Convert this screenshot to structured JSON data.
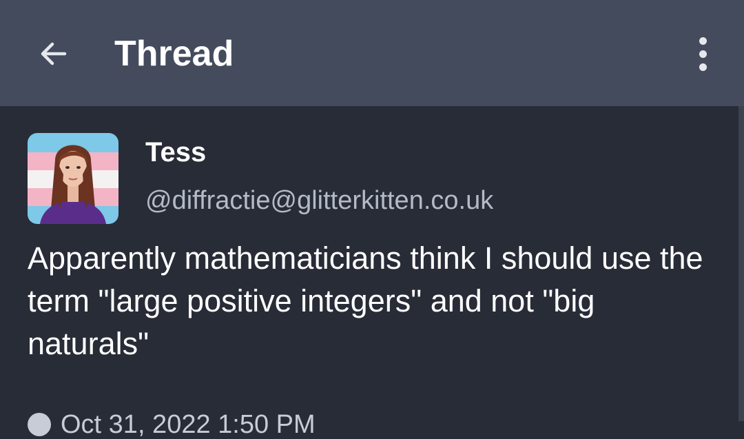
{
  "header": {
    "title": "Thread",
    "back_icon": "arrow-left-icon",
    "menu_icon": "more-vertical-icon"
  },
  "status": {
    "author": {
      "display_name": "Tess",
      "account": "@diffractie@glitterkitten.co.uk",
      "avatar_icon": "avatar-portrait"
    },
    "text": "Apparently mathematicians think I should use the term \"large positive integers\" and not \"big naturals\"",
    "timestamp": "Oct 31, 2022 1:50 PM",
    "visibility_icon": "globe-icon"
  },
  "colors": {
    "topbar": "#444b5d",
    "background": "#282c37",
    "text_primary": "#ffffff",
    "text_secondary": "#b4bac8"
  }
}
